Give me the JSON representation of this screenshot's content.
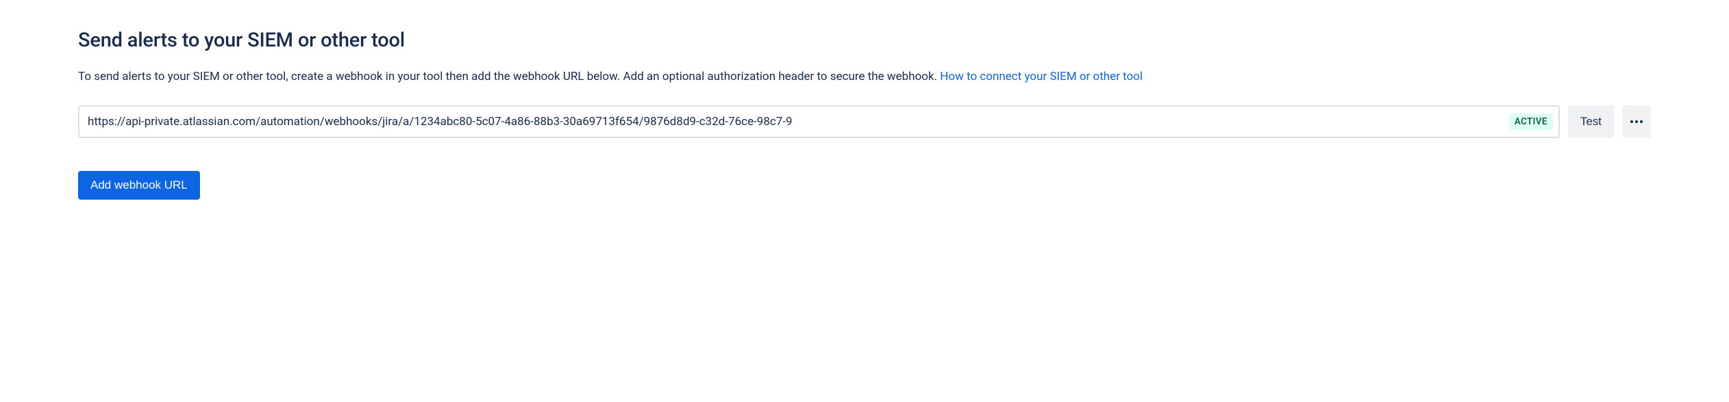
{
  "heading": "Send alerts to your SIEM or other tool",
  "description_text_before": "To send alerts to your SIEM or other tool, create a webhook in your tool then add the webhook URL below. Add an optional authorization header to secure the webhook. ",
  "description_link": "How to connect your SIEM or other tool",
  "webhook": {
    "url": "https://api-private.atlassian.com/automation/webhooks/jira/a/1234abc80-5c07-4a86-88b3-30a69713f654/9876d8d9-c32d-76ce-98c7-9",
    "status": "ACTIVE"
  },
  "buttons": {
    "test": "Test",
    "add_webhook": "Add webhook URL"
  }
}
